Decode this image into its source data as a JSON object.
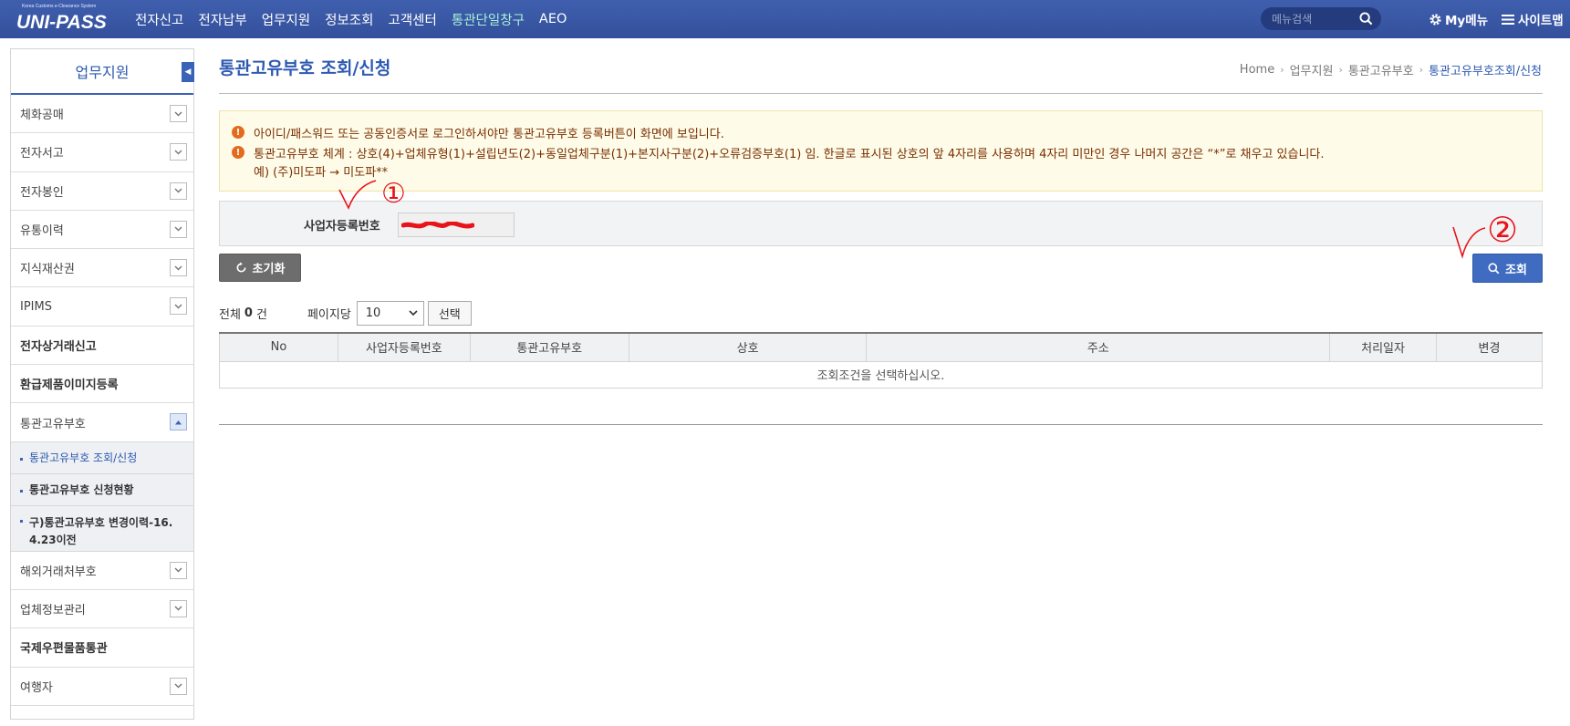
{
  "header": {
    "logo_small": "Korea Customs e-Clearance System",
    "logo_main": "UNI-PASS",
    "nav": [
      "전자신고",
      "전자납부",
      "업무지원",
      "정보조회",
      "고객센터",
      "통관단일창구",
      "AEO"
    ],
    "search_placeholder": "메뉴검색",
    "my_menu": "My메뉴",
    "sitemap": "사이트맵"
  },
  "sidebar": {
    "title": "업무지원",
    "items": [
      {
        "label": "체화공매"
      },
      {
        "label": "전자서고"
      },
      {
        "label": "전자봉인"
      },
      {
        "label": "유통이력"
      },
      {
        "label": "지식재산권"
      },
      {
        "label": "IPIMS"
      },
      {
        "label": "전자상거래신고"
      },
      {
        "label": "환급제품이미지등록"
      },
      {
        "label": "통관고유부호"
      },
      {
        "label": "해외거래처부호"
      },
      {
        "label": "업체정보관리"
      },
      {
        "label": "국제우편물품통관"
      },
      {
        "label": "여행자"
      }
    ],
    "subitems": [
      {
        "label": "통관고유부호 조회/신청"
      },
      {
        "label": "통관고유부호 신청현황"
      },
      {
        "label": "구)통관고유부호 변경이력-16.4.23이전"
      }
    ]
  },
  "page": {
    "title": "통관고유부호 조회/신청",
    "breadcrumb": [
      "Home",
      "업무지원",
      "통관고유부호",
      "통관고유부호조회/신청"
    ]
  },
  "notice": {
    "line1": "아이디/패스워드 또는 공동인증서로 로그인하셔야만 통관고유부호 등록버튼이 화면에 보입니다.",
    "line2": "통관고유부호 체계 : 상호(4)+업체유형(1)+설립년도(2)+동일업체구분(1)+본지사구분(2)+오류검증부호(1) 임. 한글로 표시된 상호의 앞 4자리를 사용하며 4자리 미만인 경우 나머지 공간은 “*”로 채우고 있습니다.",
    "line3": "예) (주)미도파 → 미도파**"
  },
  "search": {
    "label": "사업자등록번호"
  },
  "buttons": {
    "reset": "초기화",
    "search": "조회",
    "select": "선택"
  },
  "results": {
    "total_prefix": "전체",
    "total_count": "0",
    "total_suffix": "건",
    "per_page_label": "페이지당",
    "per_page_value": "10",
    "columns": [
      "No",
      "사업자등록번호",
      "통관고유부호",
      "상호",
      "주소",
      "처리일자",
      "변경"
    ],
    "empty_message": "조회조건을 선택하십시오."
  },
  "annotations": {
    "mark1": "①",
    "mark2": "②"
  },
  "colors": {
    "brand": "#3a63b8",
    "nav_bg": "#3f5fae",
    "notice_bg": "#fefce8",
    "notice_text": "#7a2d00",
    "annotation": "#e8141a"
  }
}
